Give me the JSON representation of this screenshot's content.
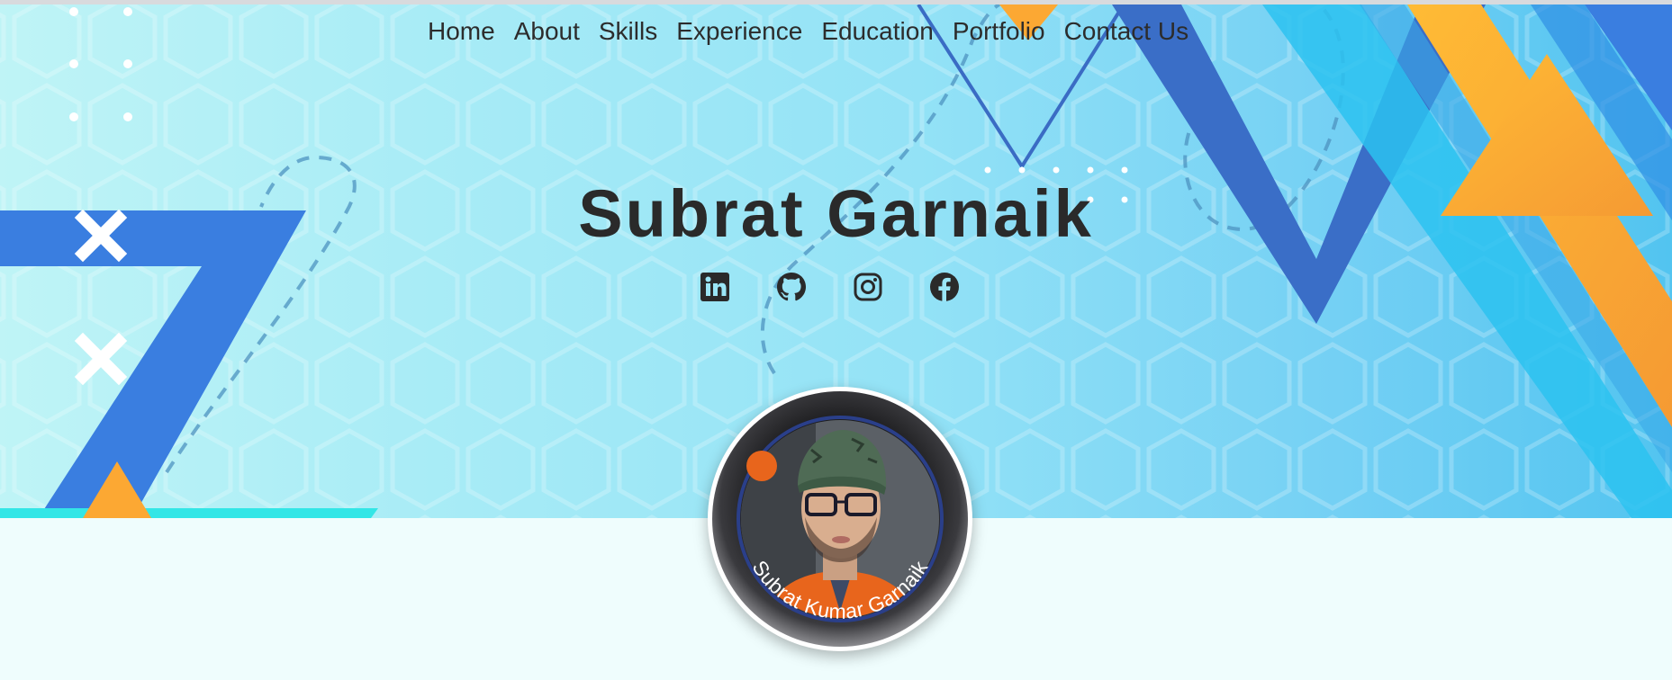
{
  "nav": {
    "items": [
      {
        "label": "Home"
      },
      {
        "label": "About"
      },
      {
        "label": "Skills"
      },
      {
        "label": "Experience"
      },
      {
        "label": "Education"
      },
      {
        "label": "Portfolio"
      },
      {
        "label": "Contact Us"
      }
    ]
  },
  "hero": {
    "name": "Subrat Garnaik"
  },
  "socials": [
    {
      "icon": "linkedin-icon"
    },
    {
      "icon": "github-icon"
    },
    {
      "icon": "instagram-icon"
    },
    {
      "icon": "facebook-icon"
    }
  ],
  "avatar": {
    "caption": "Subrat Kumar Garnaik"
  },
  "colors": {
    "accent_blue": "#3a7ee0",
    "accent_orange": "#fca833",
    "accent_cyan": "#33d6ea",
    "text_dark": "#2a2a2a"
  }
}
